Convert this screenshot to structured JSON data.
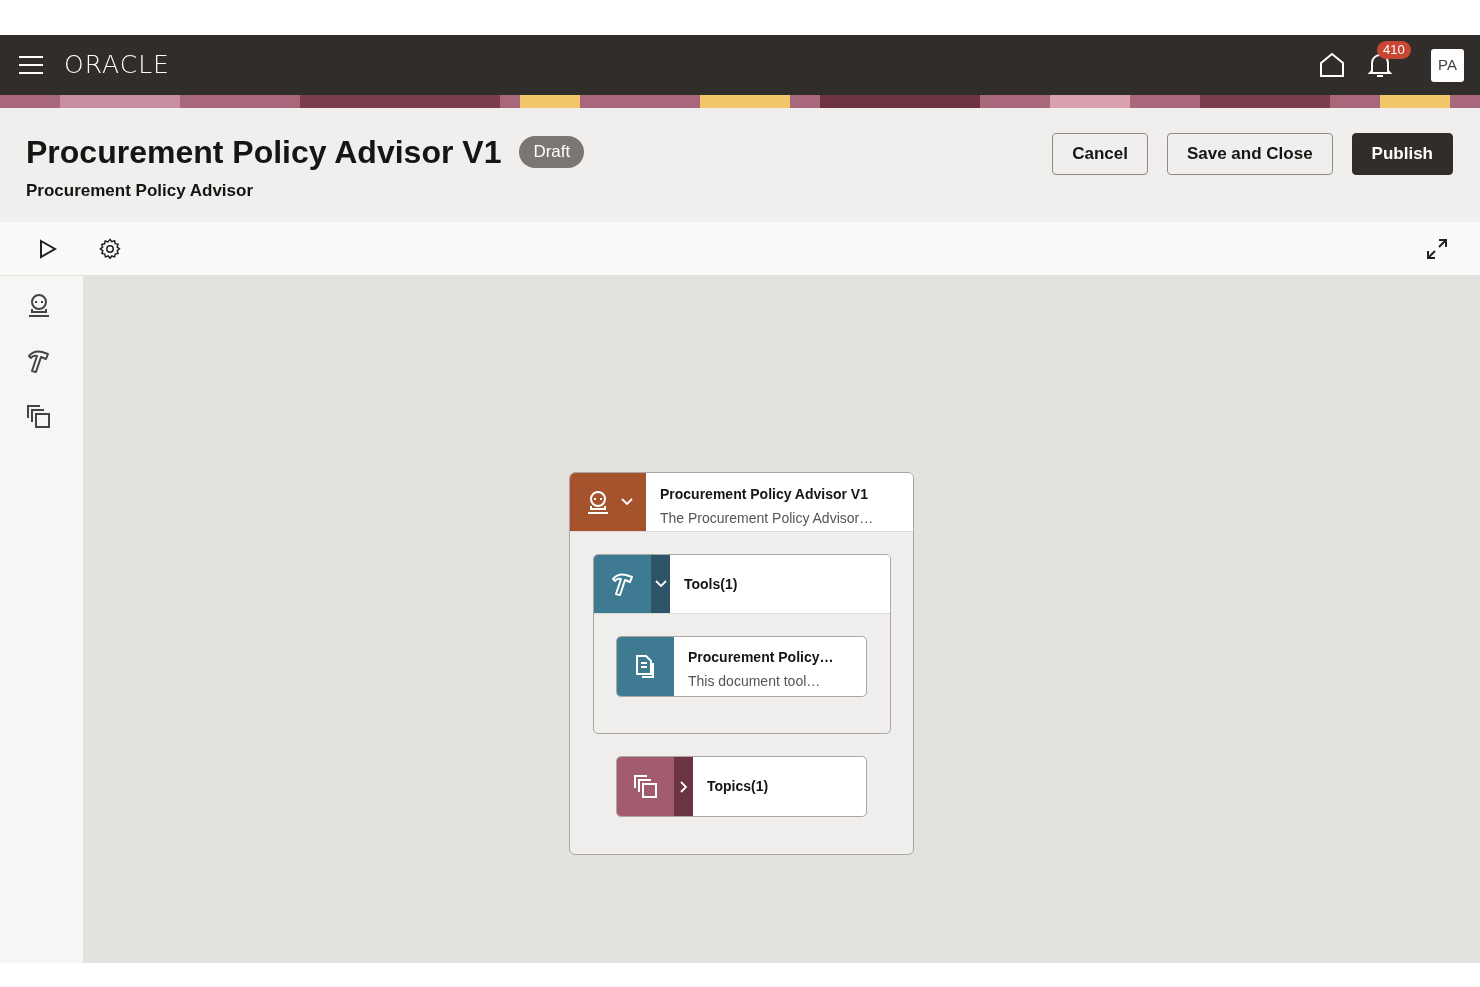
{
  "navbar": {
    "logo": "ORACLE",
    "notification_count": "410",
    "avatar": "PA"
  },
  "header": {
    "title": "Procurement Policy Advisor V1",
    "badge": "Draft",
    "subtitle": "Procurement Policy Advisor",
    "buttons": [
      {
        "label": "Cancel",
        "kind": "secondary"
      },
      {
        "label": "Save and Close",
        "kind": "secondary"
      },
      {
        "label": "Publish",
        "kind": "primary"
      }
    ]
  },
  "diagram": {
    "agent": {
      "title": "Procurement Policy Advisor V1",
      "description": "The Procurement Policy Advisor…",
      "expanded": true
    },
    "groups": [
      {
        "kind": "tools",
        "title": "Tools(1)",
        "expanded": true,
        "items": [
          {
            "title": "Procurement Policy…",
            "description": "This document tool…"
          }
        ]
      },
      {
        "kind": "topics",
        "title": "Topics(1)",
        "expanded": false
      }
    ]
  }
}
